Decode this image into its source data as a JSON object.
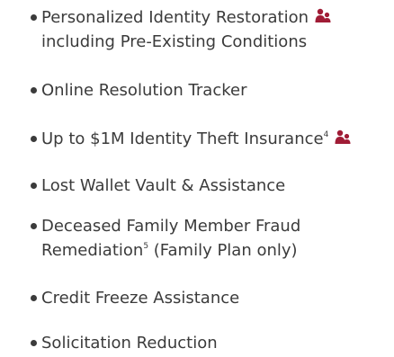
{
  "icons": {
    "family_icon": "family-icon",
    "family_icon_color": "#a01c36"
  },
  "features": [
    {
      "line1": "Personalized Identity Restoration",
      "line2": "including Pre-Existing Conditions"
    },
    {
      "line1": "Online Resolution Tracker"
    },
    {
      "line1": "Up to $1M Identity Theft Insurance",
      "sup": "4"
    },
    {
      "line1": "Lost Wallet Vault & Assistance"
    },
    {
      "line1": "Deceased Family Member Fraud",
      "line2a": "Remediation",
      "sup2": "5",
      "line2b": " (Family Plan only)"
    },
    {
      "line1": "Credit Freeze Assistance"
    },
    {
      "line1": "Solicitation Reduction"
    }
  ]
}
